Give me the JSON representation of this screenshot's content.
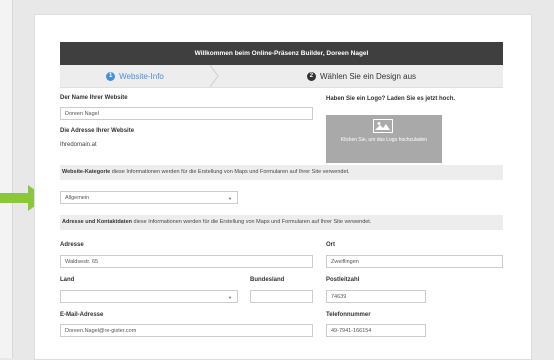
{
  "header": {
    "title": "Willkommen beim Online-Präsenz Builder, Doreen Nagel"
  },
  "steps": [
    {
      "number": "1",
      "label": "Website-Info"
    },
    {
      "number": "2",
      "label": "Wählen Sie ein Design aus"
    }
  ],
  "website": {
    "name_label": "Der Name Ihrer Website",
    "name_value": "Doreen Nagel",
    "address_label": "Die Adresse Ihrer Website",
    "address_value": "Ihredomain.at"
  },
  "logo": {
    "question": "Haben Sie ein Logo? Laden Sie es jetzt hoch.",
    "upload_label": "Klicken Sie, um das Logo hochzuladen"
  },
  "category": {
    "title": "Website-Kategorie",
    "description": "diese Informationen werden für die Erstellung von Maps und Formularen auf Ihrer Site verwendet.",
    "selected": "Allgemein"
  },
  "contact": {
    "title": "Adresse und Kontaktdaten",
    "description": "diese Informationen werden für die Erstellung von Maps und Formularen auf Ihrer Site verwendet.",
    "address_label": "Adresse",
    "address_value": "Waldsestr. 65",
    "city_label": "Ort",
    "city_value": "Zweiflingen",
    "country_label": "Land",
    "country_value": "",
    "state_label": "Bundesland",
    "state_value": "",
    "zip_label": "Postleitzahl",
    "zip_value": "74639",
    "email_label": "E-Mail-Adresse",
    "email_value": "Doreen.Nagel@re-gister.com",
    "phone_label": "Telefonnummer",
    "phone_value": "49-7941-166154"
  },
  "colors": {
    "accent": "#4a90d9",
    "arrow": "#8cc63f",
    "header": "#3f3f3f"
  }
}
